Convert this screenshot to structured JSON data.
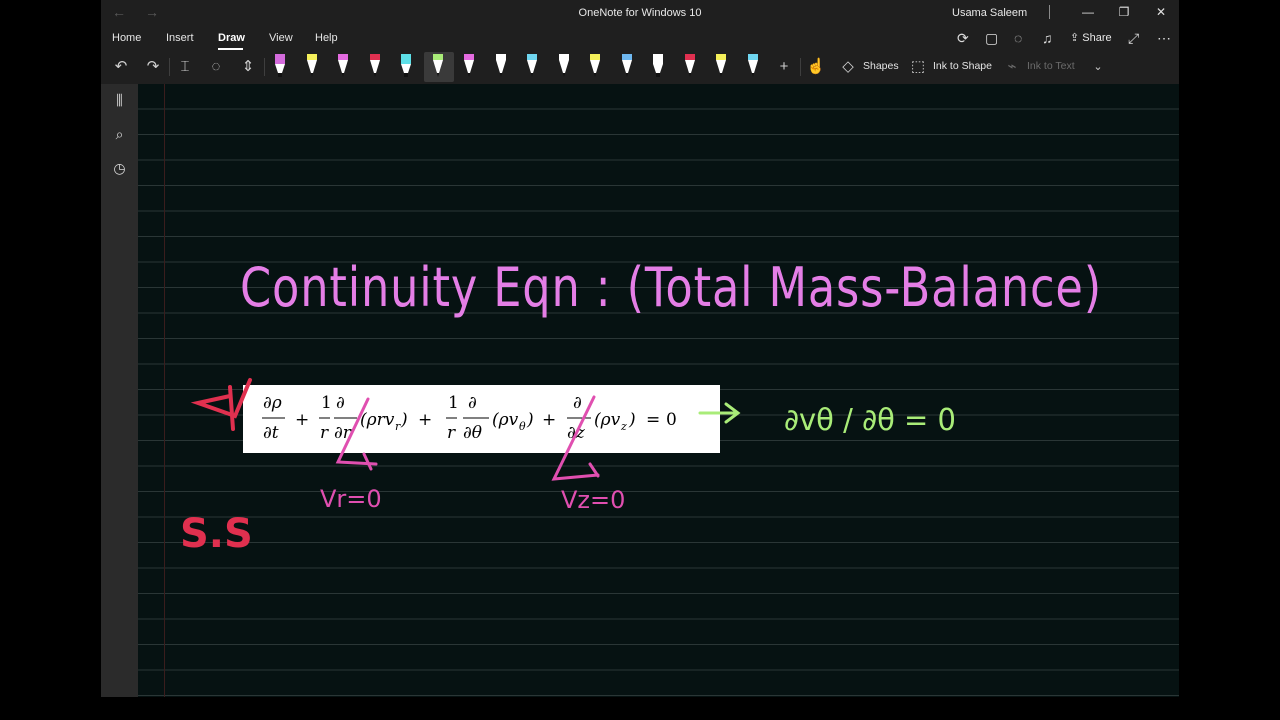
{
  "window": {
    "title": "OneNote for Windows 10",
    "user": "Usama Saleem",
    "back_icon": "←",
    "forward_icon": "→",
    "minimize_icon": "—",
    "restore_icon": "❐",
    "close_icon": "✕"
  },
  "ribbon": {
    "tabs": [
      "Home",
      "Insert",
      "Draw",
      "View",
      "Help"
    ],
    "active_tab": "Draw",
    "share_label": "Share"
  },
  "toolbar": {
    "shapes_label": "Shapes",
    "ink_to_shape_label": "Ink to Shape",
    "ink_to_text_label": "Ink to Text",
    "pens": [
      {
        "kind": "highlighter",
        "color": "#d46bdc"
      },
      {
        "kind": "pen",
        "color": "#f5f05a"
      },
      {
        "kind": "pen",
        "color": "#e46be0"
      },
      {
        "kind": "pen",
        "color": "#e03050"
      },
      {
        "kind": "highlighter",
        "color": "#5ee0e8"
      },
      {
        "kind": "pen",
        "color": "#a9ec78"
      },
      {
        "kind": "pen",
        "color": "#e46be0"
      },
      {
        "kind": "pen",
        "color": "#ffffff"
      },
      {
        "kind": "pen",
        "color": "#6fd6f0"
      },
      {
        "kind": "pen",
        "color": "#ffffff"
      },
      {
        "kind": "pen",
        "color": "#f5f05a"
      },
      {
        "kind": "pen",
        "color": "#6fb8f0"
      },
      {
        "kind": "highlighter",
        "color": "#ffffff"
      },
      {
        "kind": "pen",
        "color": "#e03050"
      },
      {
        "kind": "pen",
        "color": "#f5f05a"
      },
      {
        "kind": "pen",
        "color": "#6fd6f0"
      }
    ]
  },
  "note": {
    "heading_ink": "Continuity Eqn : (Total Mass-Balance)",
    "equation_text": "∂ρ/∂t + (1/r) ∂/∂r (ρ r v_r) + (1/r) ∂/∂θ (ρ v_θ) + ∂/∂z (ρ v_z) = 0",
    "annotations": {
      "ss": "S.S",
      "vr": "Vr=0",
      "vz": "Vz=0",
      "result": "∂vθ / ∂θ = 0"
    },
    "colors": {
      "heading": "#e47ee6",
      "ss": "#e0304f",
      "pink": "#e04fb0",
      "result": "#a9ec78",
      "page_bg": "#061212",
      "rule_line": "#2a3636"
    }
  }
}
